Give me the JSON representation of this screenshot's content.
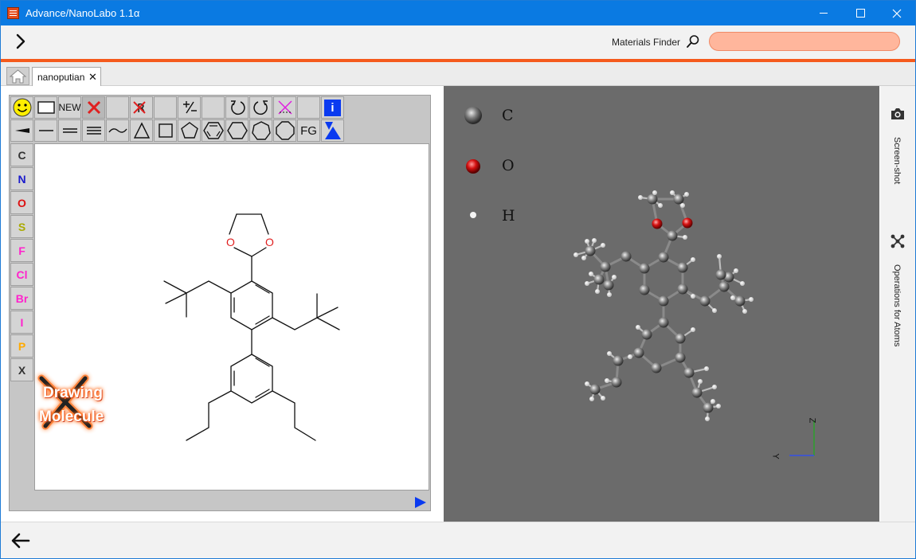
{
  "window": {
    "title": "Advance/NanoLabo 1.1α"
  },
  "appbar": {
    "finder_label": "Materials Finder",
    "finder_value": "",
    "finder_placeholder": ""
  },
  "tabs": {
    "document_label": "nanoputian",
    "close_glyph": "✕"
  },
  "toolbar_row1": [
    {
      "name": "smiley",
      "icon": "smiley-icon"
    },
    {
      "name": "blank-rect",
      "icon": "rectangle-icon"
    },
    {
      "name": "new",
      "label": "NEW"
    },
    {
      "name": "delete",
      "icon": "red-x-icon"
    },
    {
      "name": "empty",
      "label": ""
    },
    {
      "name": "remove-r",
      "icon": "strike-r-icon"
    },
    {
      "name": "empty2",
      "label": ""
    },
    {
      "name": "charge",
      "icon": "plus-minus-icon"
    },
    {
      "name": "empty3",
      "label": ""
    },
    {
      "name": "rotate-left",
      "icon": "rotate-ccw-icon"
    },
    {
      "name": "rotate-right",
      "icon": "rotate-cw-icon"
    },
    {
      "name": "clear-selection",
      "icon": "magenta-x-icon"
    },
    {
      "name": "empty4",
      "label": ""
    },
    {
      "name": "info",
      "label": "i"
    }
  ],
  "toolbar_row2": [
    {
      "name": "wedge-bond",
      "icon": "wedge-icon"
    },
    {
      "name": "single-bond",
      "icon": "single-bond-icon"
    },
    {
      "name": "double-bond",
      "icon": "double-bond-icon"
    },
    {
      "name": "triple-bond",
      "icon": "triple-bond-icon"
    },
    {
      "name": "chain",
      "icon": "chain-icon"
    },
    {
      "name": "ring3",
      "icon": "triangle-icon"
    },
    {
      "name": "ring4",
      "icon": "square-icon"
    },
    {
      "name": "ring5",
      "icon": "pentagon-icon"
    },
    {
      "name": "benzene",
      "icon": "benzene-icon"
    },
    {
      "name": "ring6",
      "icon": "hexagon-icon"
    },
    {
      "name": "ring7",
      "icon": "heptagon-icon"
    },
    {
      "name": "ring8",
      "icon": "octagon-icon"
    },
    {
      "name": "functional-group",
      "label": "FG"
    },
    {
      "name": "templates",
      "icon": "blue-triangles-icon"
    }
  ],
  "elements": [
    {
      "symbol": "C",
      "color": "#333333"
    },
    {
      "symbol": "N",
      "color": "#1a1acc"
    },
    {
      "symbol": "O",
      "color": "#dd1111"
    },
    {
      "symbol": "S",
      "color": "#aaaa00"
    },
    {
      "symbol": "F",
      "color": "#ff22cc"
    },
    {
      "symbol": "Cl",
      "color": "#ff22cc"
    },
    {
      "symbol": "Br",
      "color": "#ff22cc"
    },
    {
      "symbol": "I",
      "color": "#ff22cc"
    },
    {
      "symbol": "P",
      "color": "#ffaa00"
    },
    {
      "symbol": "X",
      "color": "#333333"
    }
  ],
  "molecule_labels": {
    "o1": "O",
    "o2": "O"
  },
  "watermark": {
    "line1": "Drawing",
    "line2": "Molecule"
  },
  "legend": [
    {
      "label": "C",
      "color": "#8a8a8a"
    },
    {
      "label": "O",
      "color": "#d41010"
    },
    {
      "label": "H",
      "color": "#f2f2f2"
    }
  ],
  "axes": {
    "z": "Z",
    "y": "Y"
  },
  "sidebar": {
    "screenshot_label": "Screen-shot",
    "operations_label": "Operations for Atoms"
  },
  "colors": {
    "titlebar": "#0a7ae2",
    "accent_rule": "#f55a1c",
    "finder_input": "#ffb69c",
    "viewer_bg": "#6b6b6b"
  }
}
